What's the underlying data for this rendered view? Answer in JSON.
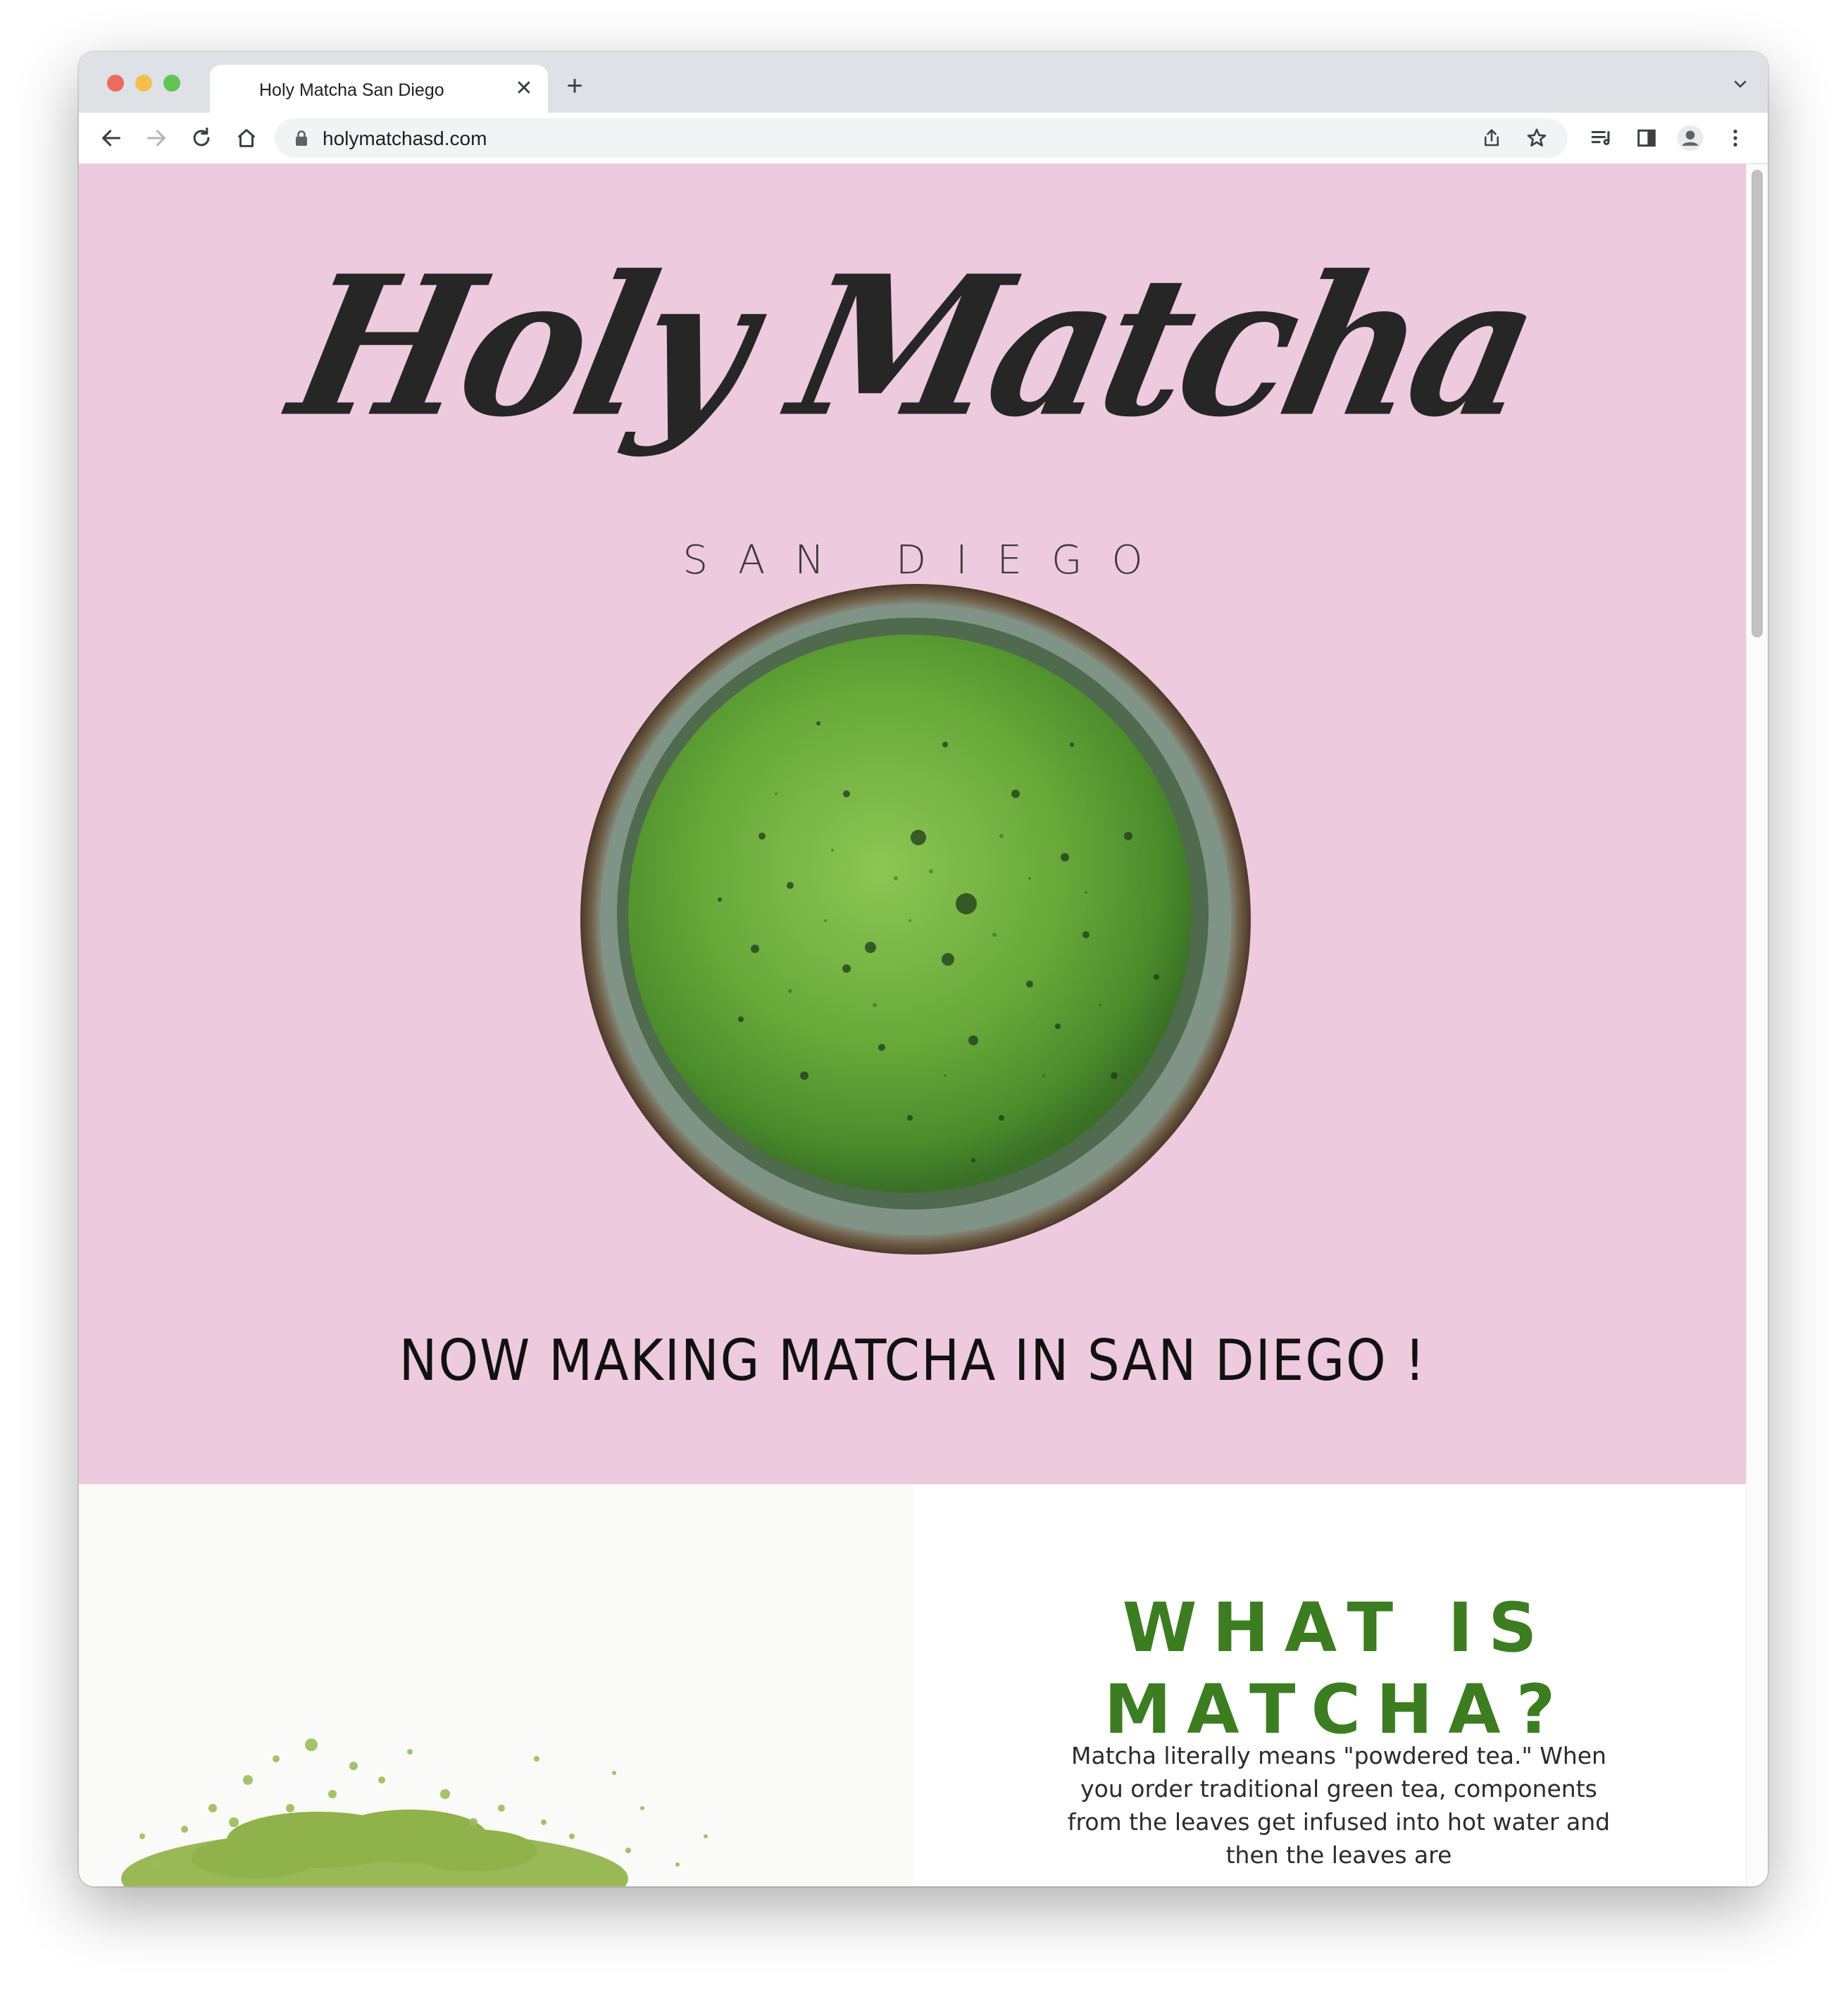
{
  "browser": {
    "tab_title": "Holy Matcha San Diego",
    "tab_close": "✕",
    "new_tab": "+",
    "url": "holymatchasd.com"
  },
  "hero": {
    "logo_text": "Holy Matcha",
    "logo_subtitle": "SAN DIEGO",
    "tagline": "NOW MAKING MATCHA IN SAN DIEGO !",
    "background_color": "#eecade"
  },
  "about": {
    "heading_line1": "WHAT IS",
    "heading_line2": "MATCHA?",
    "body": "Matcha literally means \"powdered tea.\" When you order traditional green tea, components from the leaves get infused into hot water and then the leaves are",
    "heading_color": "#3d7d21"
  },
  "icons": {
    "back": "arrow-left-icon",
    "forward": "arrow-right-icon",
    "reload": "reload-icon",
    "home": "home-icon",
    "lock": "lock-icon",
    "share": "share-icon",
    "bookmark": "star-icon",
    "reading_list": "reading-list-icon",
    "side_panel": "side-panel-icon",
    "profile": "profile-icon",
    "menu": "kebab-menu-icon"
  }
}
